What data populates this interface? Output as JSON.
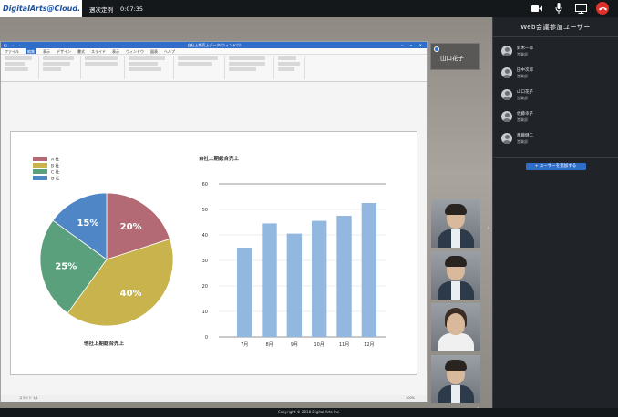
{
  "header": {
    "logo": "DigitalArts@Cloud.",
    "meeting_title": "週次定例",
    "timer": "0:07:35"
  },
  "document_window": {
    "title": "自社上期売上データ(ウィンドウ)",
    "menu": [
      "ファイル",
      "編集",
      "表示",
      "デザイン",
      "書式",
      "スライド",
      "表示",
      "ウィンドウ",
      "図表",
      "ヘルプ"
    ],
    "status_left": "スライド 1/1",
    "status_zoom": "100%"
  },
  "chart_data": [
    {
      "type": "pie",
      "title": "他社上期総合売上",
      "legend": [
        "A 社",
        "B 社",
        "C 社",
        "D 社"
      ],
      "labels": [
        "20%",
        "40%",
        "25%",
        "15%"
      ],
      "values": [
        20,
        40,
        25,
        15
      ],
      "colors": [
        "#b46a74",
        "#c8b34c",
        "#5aa07c",
        "#4f86c6"
      ],
      "legend_position": "top-left"
    },
    {
      "type": "bar",
      "title": "自社上期総合売上",
      "categories": [
        "7月",
        "8月",
        "9月",
        "10月",
        "11月",
        "12月"
      ],
      "values": [
        35,
        44.5,
        40.5,
        45.5,
        47.5,
        52.5
      ],
      "ylim": [
        0,
        60
      ],
      "yticks": [
        "0",
        "10",
        "20",
        "30",
        "40",
        "50",
        "60"
      ],
      "color": "#93b8e0",
      "grid": true
    }
  ],
  "selfview": {
    "name": "山口花子"
  },
  "sidebar": {
    "title": "Web会議参加ユーザー",
    "users": [
      {
        "name": "鈴木一郎",
        "dept": "営業部"
      },
      {
        "name": "田中次郎",
        "dept": "営業部"
      },
      {
        "name": "山口花子",
        "dept": "営業部"
      },
      {
        "name": "佐藤幸子",
        "dept": "営業部"
      },
      {
        "name": "斎藤健二",
        "dept": "営業部"
      }
    ],
    "add_button": "+ ユーザーを追加する"
  },
  "footer": {
    "copyright": "Copyright © 2018 Digital Arts Inc."
  },
  "colors": {
    "accent": "#2e6ec8",
    "hangup": "#e0302b",
    "sidebar_bg": "#202327"
  }
}
